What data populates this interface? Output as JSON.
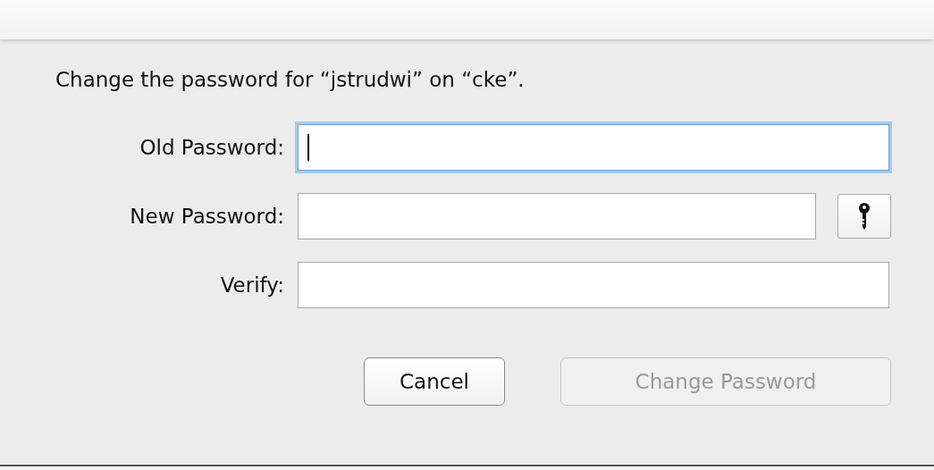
{
  "dialog": {
    "title": "Change the password for “jstrudwi” on “cke”.",
    "fields": [
      {
        "label": "Old Password:",
        "focused": true,
        "key_button": false
      },
      {
        "label": "New Password:",
        "focused": false,
        "key_button": true
      },
      {
        "label": "Verify:",
        "focused": false,
        "key_button": false
      }
    ],
    "buttons": [
      {
        "label": "Cancel",
        "disabled": false
      },
      {
        "label": "Change Password",
        "disabled": true
      }
    ]
  }
}
